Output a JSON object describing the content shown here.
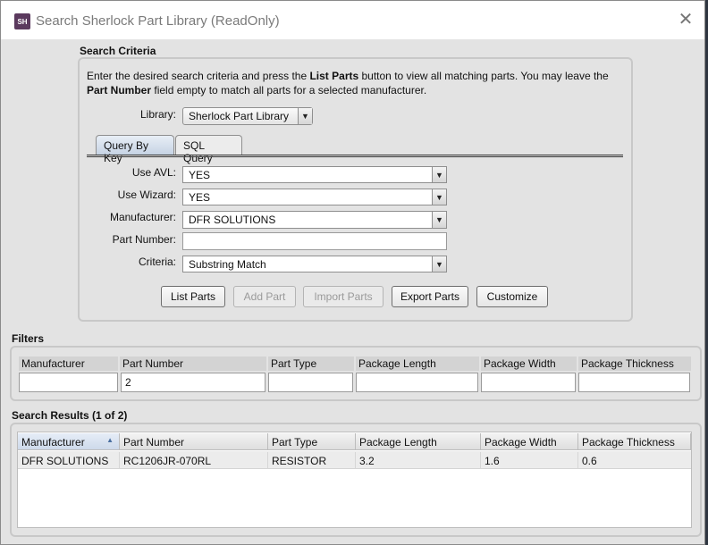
{
  "window": {
    "logo_text": "SH",
    "title": "Search Sherlock Part Library (ReadOnly)",
    "close_glyph": "✕"
  },
  "search_criteria": {
    "section_title": "Search Criteria",
    "intro_part1": "Enter the desired search criteria and press the ",
    "intro_bold1": "List Parts",
    "intro_part2": " button to view all matching parts. You may leave the ",
    "intro_bold2": "Part Number",
    "intro_part3": " field empty to match all parts for a selected manufacturer.",
    "library_label": "Library:",
    "library_value": "Sherlock Part Library",
    "tabs": [
      {
        "label": "Query By Key",
        "active": true
      },
      {
        "label": "SQL Query",
        "active": false
      }
    ],
    "fields": {
      "use_avl_label": "Use AVL:",
      "use_avl_value": "YES",
      "use_wizard_label": "Use Wizard:",
      "use_wizard_value": "YES",
      "manufacturer_label": "Manufacturer:",
      "manufacturer_value": "DFR SOLUTIONS",
      "part_number_label": "Part Number:",
      "part_number_value": "",
      "criteria_label": "Criteria:",
      "criteria_value": "Substring Match"
    },
    "buttons": {
      "list_parts": "List Parts",
      "add_part": "Add Part",
      "import_parts": "Import Parts",
      "export_parts": "Export Parts",
      "customize": "Customize"
    }
  },
  "filters": {
    "section_title": "Filters",
    "columns": [
      "Manufacturer",
      "Part Number",
      "Part Type",
      "Package Length",
      "Package Width",
      "Package Thickness"
    ],
    "values": [
      "",
      "2",
      "",
      "",
      "",
      ""
    ]
  },
  "results": {
    "section_title": "Search Results (1 of 2)",
    "columns": [
      "Manufacturer",
      "Part Number",
      "Part Type",
      "Package Length",
      "Package Width",
      "Package Thickness"
    ],
    "sort_icon": "▲",
    "rows": [
      [
        "DFR SOLUTIONS",
        "RC1206JR-070RL",
        "RESISTOR",
        "3.2",
        "1.6",
        "0.6"
      ]
    ]
  },
  "dropdown_glyph": "▼"
}
